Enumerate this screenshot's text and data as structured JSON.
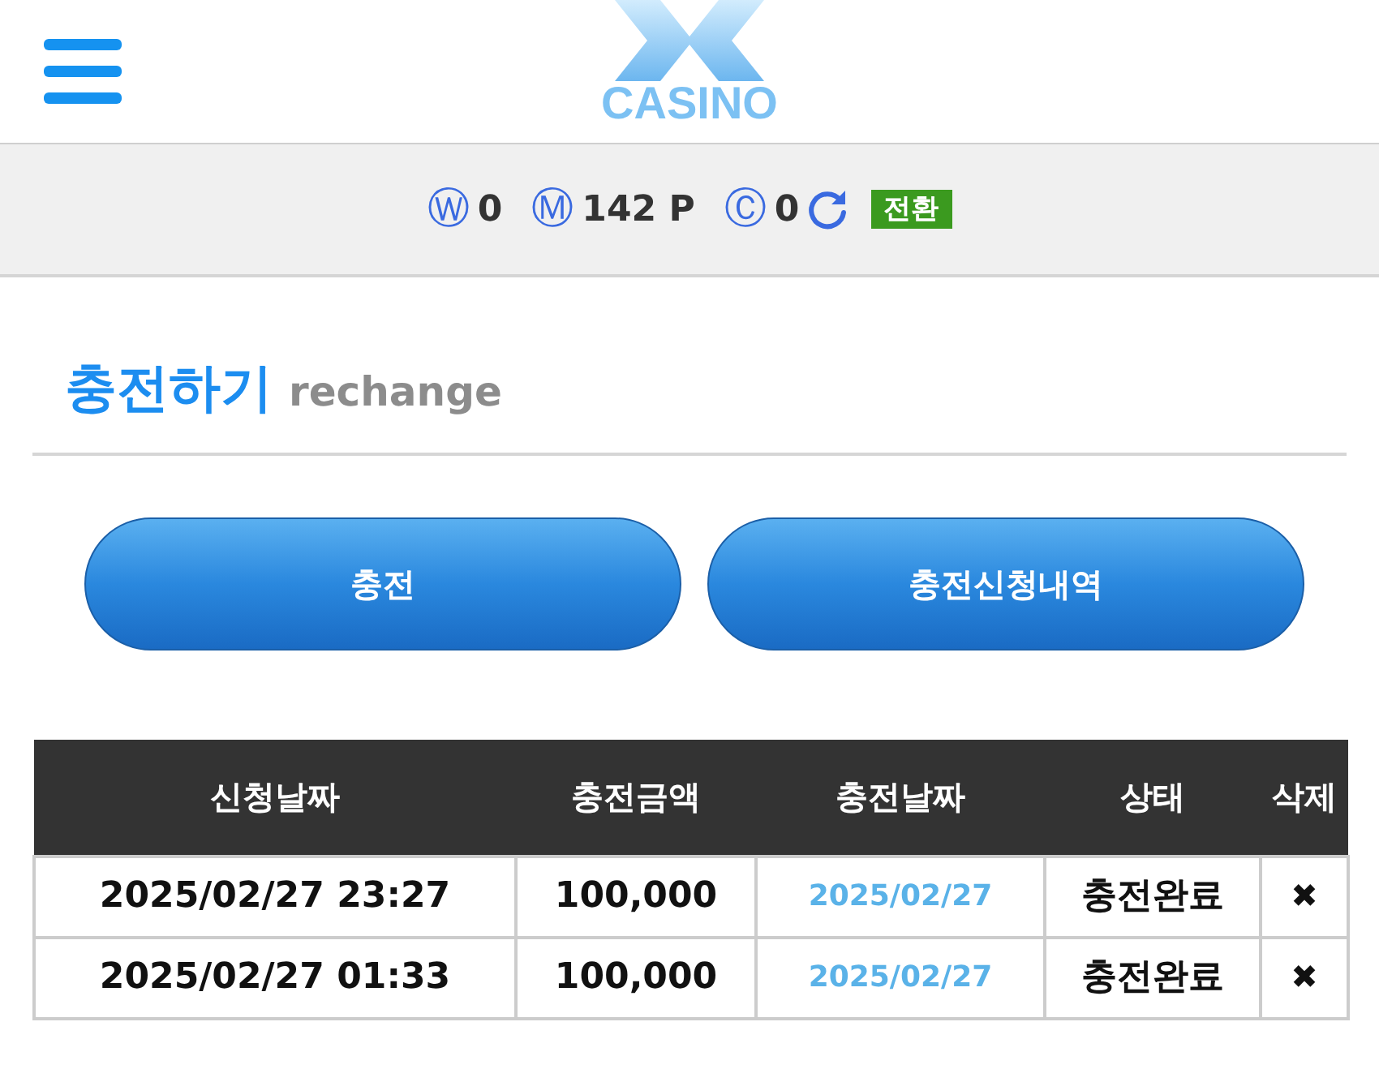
{
  "header": {
    "logo_text": "CASINO"
  },
  "balance_bar": {
    "items": [
      {
        "symbol": "Ⓦ",
        "value": "0"
      },
      {
        "symbol": "Ⓜ",
        "value": "142 P"
      },
      {
        "symbol": "Ⓒ",
        "value": "0"
      }
    ],
    "convert_button": "전환"
  },
  "page_title": {
    "title": "충전하기",
    "subtitle": "rechange"
  },
  "buttons": [
    {
      "label": "충전"
    },
    {
      "label": "충전신청내역"
    }
  ],
  "table": {
    "columns": [
      "신청날짜",
      "충전금액",
      "충전날짜",
      "상태",
      "삭제"
    ],
    "rows": [
      {
        "requested": "2025/02/27 23:27",
        "amount": "100,000",
        "charged": "2025/02/27",
        "status": "충전완료",
        "delete": "✖"
      },
      {
        "requested": "2025/02/27 01:33",
        "amount": "100,000",
        "charged": "2025/02/27",
        "status": "충전완료",
        "delete": "✖"
      }
    ]
  }
}
